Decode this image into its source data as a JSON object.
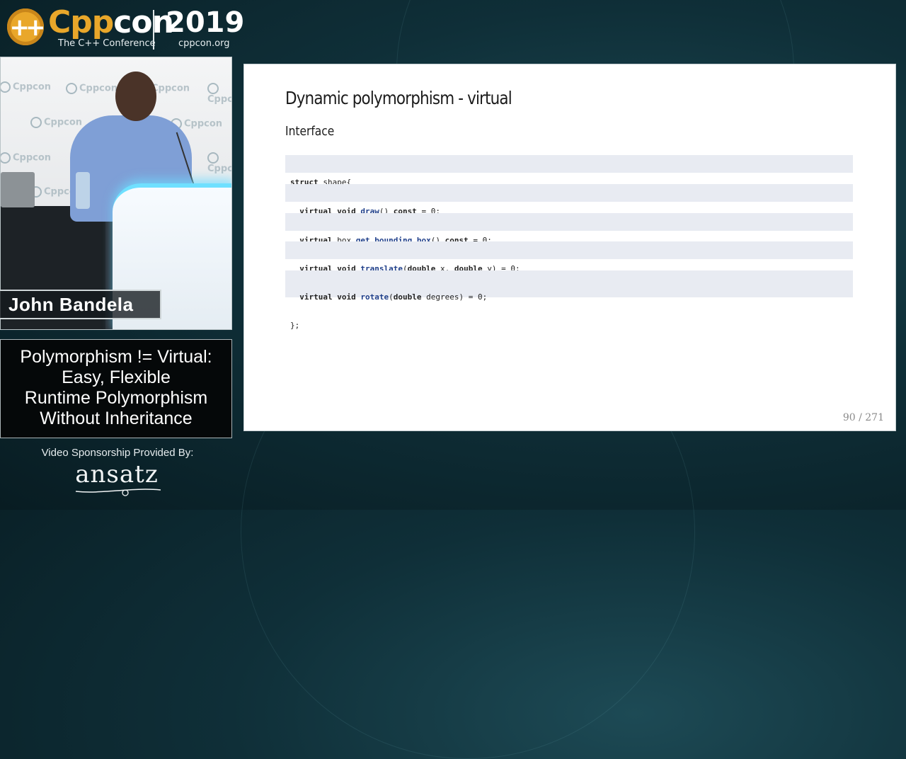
{
  "conference": {
    "logo_mark": "++",
    "name_part1": "Cpp",
    "name_part2": "con",
    "tagline": "The C++ Conference",
    "year": "2019",
    "website": "cppcon.org"
  },
  "speaker": {
    "name": "John Bandela",
    "wall_logo_text": "Cppcon"
  },
  "talk": {
    "title_lines": [
      "Polymorphism != Virtual:",
      "Easy, Flexible",
      "Runtime Polymorphism",
      "Without Inheritance"
    ]
  },
  "sponsor": {
    "label": "Video Sponsorship Provided By:",
    "name": "ansatz"
  },
  "slide": {
    "title": "Dynamic polymorphism - virtual",
    "subtitle": "Interface",
    "page": "90 / 271",
    "code": {
      "line1": {
        "kw": "struct",
        "rest": " shape{"
      },
      "line2": {
        "kw1": "virtual",
        "kw2": "void",
        "fn": "draw",
        "mid": "() ",
        "kw3": "const",
        "rest": " = 0;"
      },
      "line3": {
        "kw1": "virtual",
        "plain1": " box ",
        "fn": "get_bounding_box",
        "mid": "() ",
        "kw3": "const",
        "rest": " = 0;"
      },
      "line4": {
        "kw1": "virtual",
        "kw2": "void",
        "fn": "translate",
        "p1": "(",
        "kw3": "double",
        "p2": " x, ",
        "kw4": "double",
        "rest": " y) = 0;"
      },
      "line5": {
        "kw1": "virtual",
        "kw2": "void",
        "fn": "rotate",
        "p1": "(",
        "kw3": "double",
        "rest": " degrees) = 0;"
      },
      "line6": "};"
    }
  },
  "colors": {
    "logo_orange": "#e9a72a",
    "code_bg": "#e8ebf2",
    "function_blue": "#1f3f8a",
    "background_teal": "#0f2f38"
  }
}
